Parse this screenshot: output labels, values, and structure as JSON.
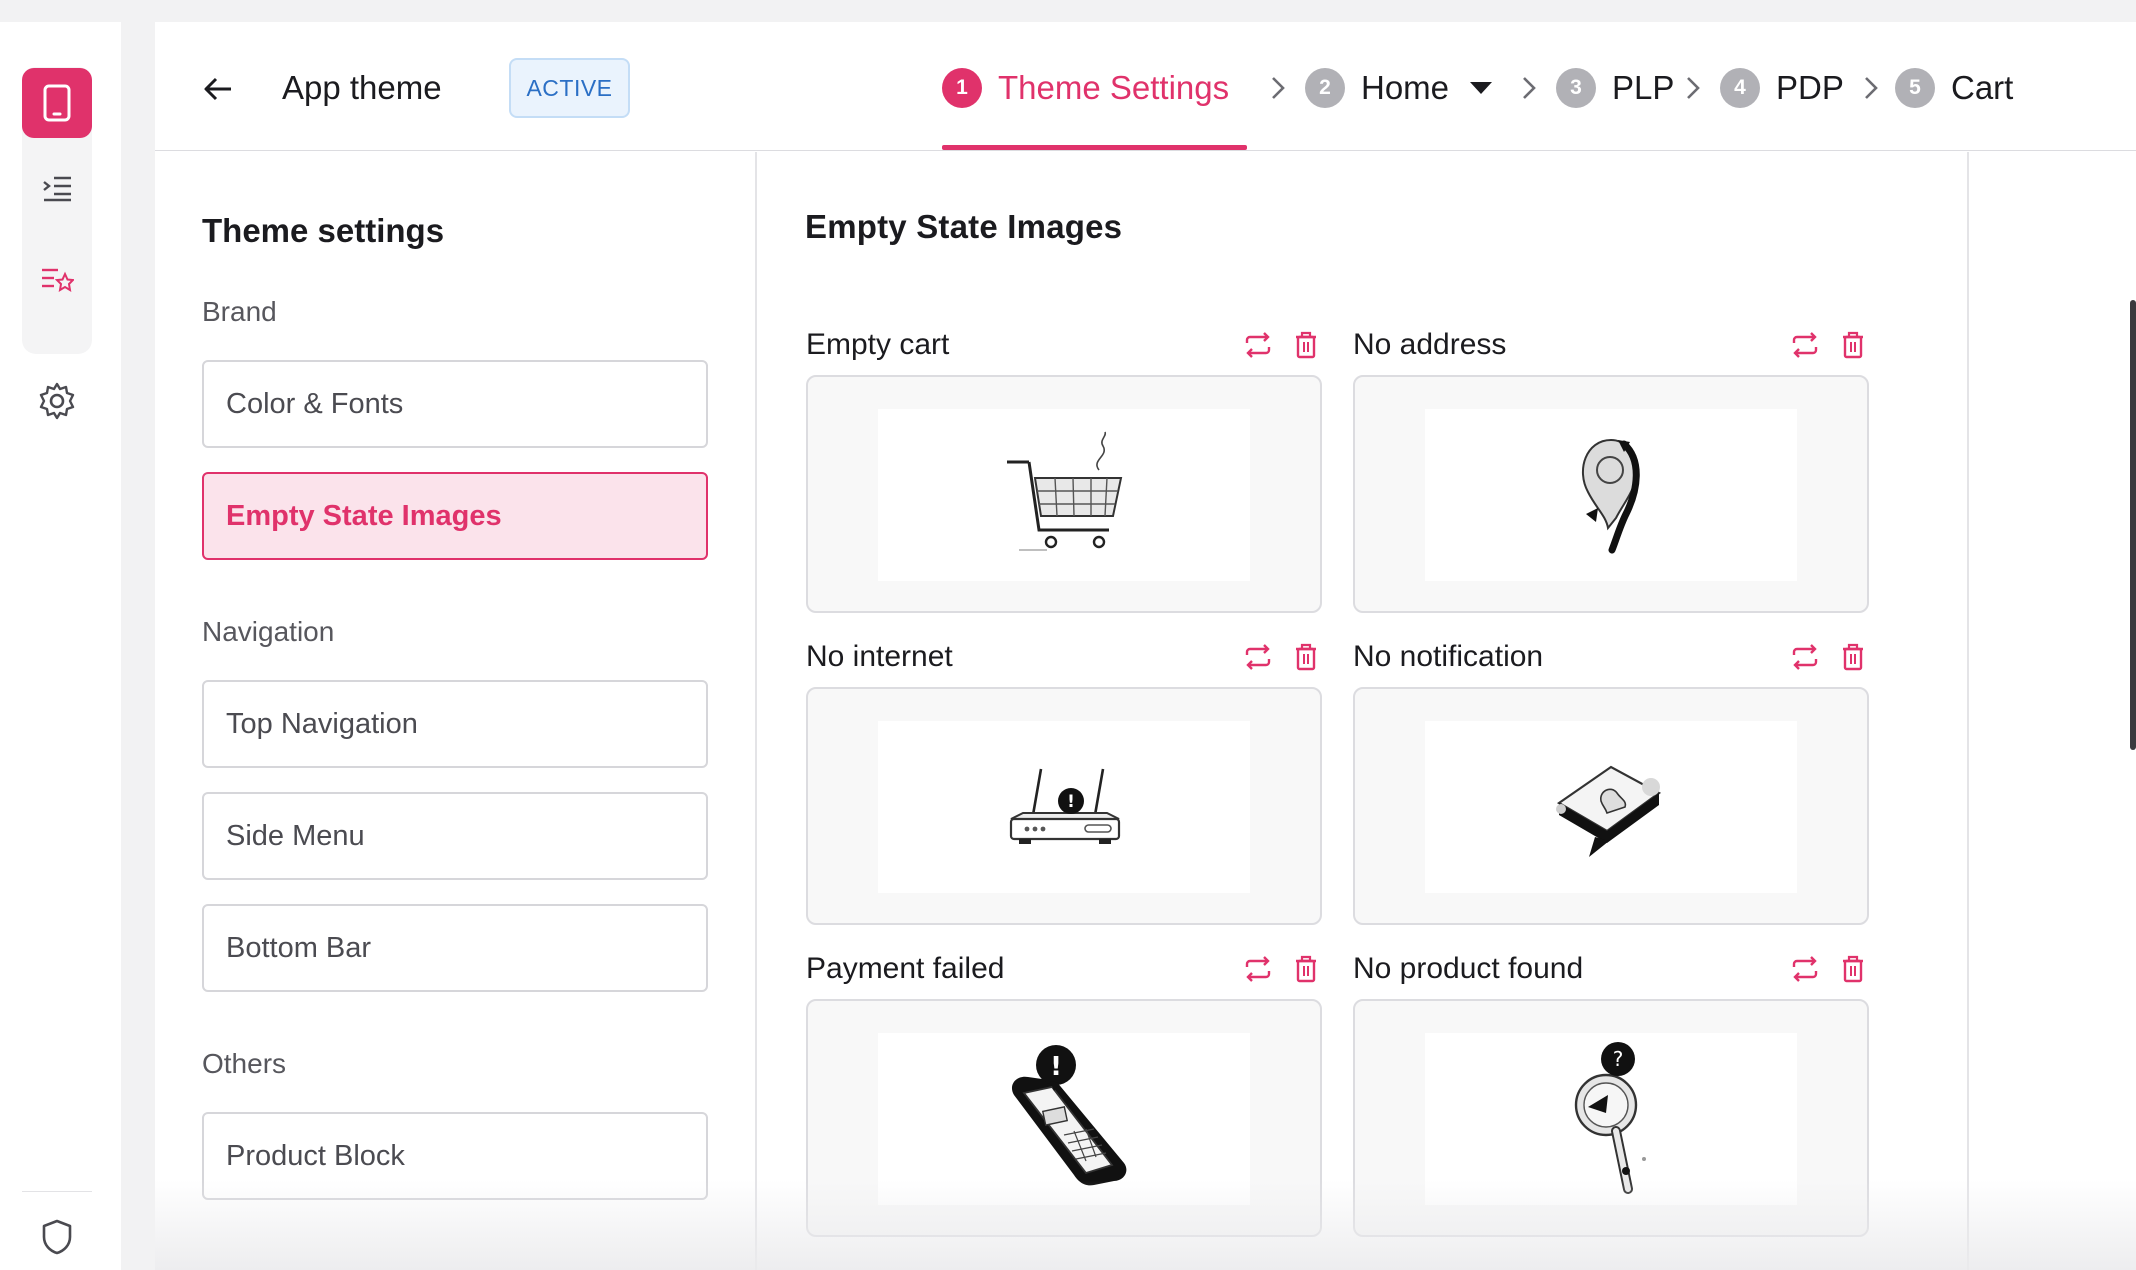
{
  "header": {
    "title": "App theme",
    "status_badge": "ACTIVE",
    "steps": [
      {
        "num": "1",
        "label": "Theme Settings"
      },
      {
        "num": "2",
        "label": "Home"
      },
      {
        "num": "3",
        "label": "PLP"
      },
      {
        "num": "4",
        "label": "PDP"
      },
      {
        "num": "5",
        "label": "Cart"
      }
    ]
  },
  "settings": {
    "title": "Theme settings",
    "groups": {
      "brand": "Brand",
      "navigation": "Navigation",
      "others": "Others"
    },
    "items": {
      "color_fonts": "Color & Fonts",
      "empty_state_images": "Empty State Images",
      "top_navigation": "Top Navigation",
      "side_menu": "Side Menu",
      "bottom_bar": "Bottom Bar",
      "product_block": "Product Block"
    },
    "active_item": "Empty State Images"
  },
  "content": {
    "title": "Empty State Images",
    "cards": [
      {
        "label": "Empty cart",
        "illustration": "cart-illustration"
      },
      {
        "label": "No address",
        "illustration": "map-pin-illustration"
      },
      {
        "label": "No internet",
        "illustration": "router-illustration"
      },
      {
        "label": "No notification",
        "illustration": "notification-illustration"
      },
      {
        "label": "Payment failed",
        "illustration": "card-terminal-illustration"
      },
      {
        "label": "No product found",
        "illustration": "magnifier-illustration"
      }
    ]
  },
  "colors": {
    "accent": "#e0326b",
    "badge_bg": "#eaf3fd",
    "badge_text": "#2b6fc5"
  }
}
